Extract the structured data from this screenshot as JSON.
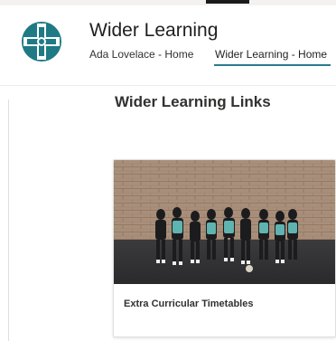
{
  "site": {
    "title": "Wider Learning",
    "logo_icon": "cross-shield-logo-icon",
    "brand_color": "#1f7a86"
  },
  "nav": {
    "items": [
      {
        "label": "Ada Lovelace - Home",
        "active": false
      },
      {
        "label": "Wider Learning - Home",
        "active": true
      }
    ]
  },
  "section": {
    "title": "Wider Learning Links"
  },
  "cards": [
    {
      "label": "Extra Curricular Timetables",
      "image_icon": "netball-team-photo"
    }
  ]
}
